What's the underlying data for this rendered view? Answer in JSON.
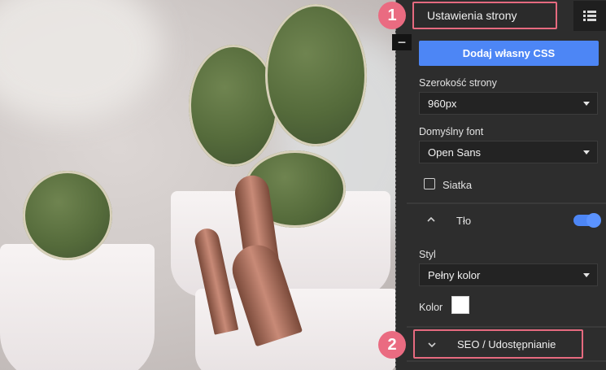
{
  "panel": {
    "title": "Ustawienia strony",
    "custom_css_button": "Dodaj własny CSS",
    "page_width": {
      "label": "Szerokość strony",
      "value": "960px"
    },
    "default_font": {
      "label": "Domyślny font",
      "value": "Open Sans"
    },
    "grid": {
      "label": "Siatka",
      "checked": false
    },
    "background": {
      "label": "Tło",
      "enabled": true,
      "style_label": "Styl",
      "style_value": "Pełny kolor",
      "color_label": "Kolor",
      "color_value": "#ffffff"
    },
    "seo_section": "SEO / Udostępnianie"
  },
  "collapse_symbol": "−",
  "badges": [
    "1",
    "2"
  ],
  "colors": {
    "accent": "#4d86f5",
    "highlight": "#e66a7f",
    "panel_bg": "#2d2d2d"
  },
  "icons": [
    "list-icon",
    "chevron-up-icon",
    "chevron-down-icon",
    "dropdown-caret-icon",
    "minus-icon"
  ]
}
